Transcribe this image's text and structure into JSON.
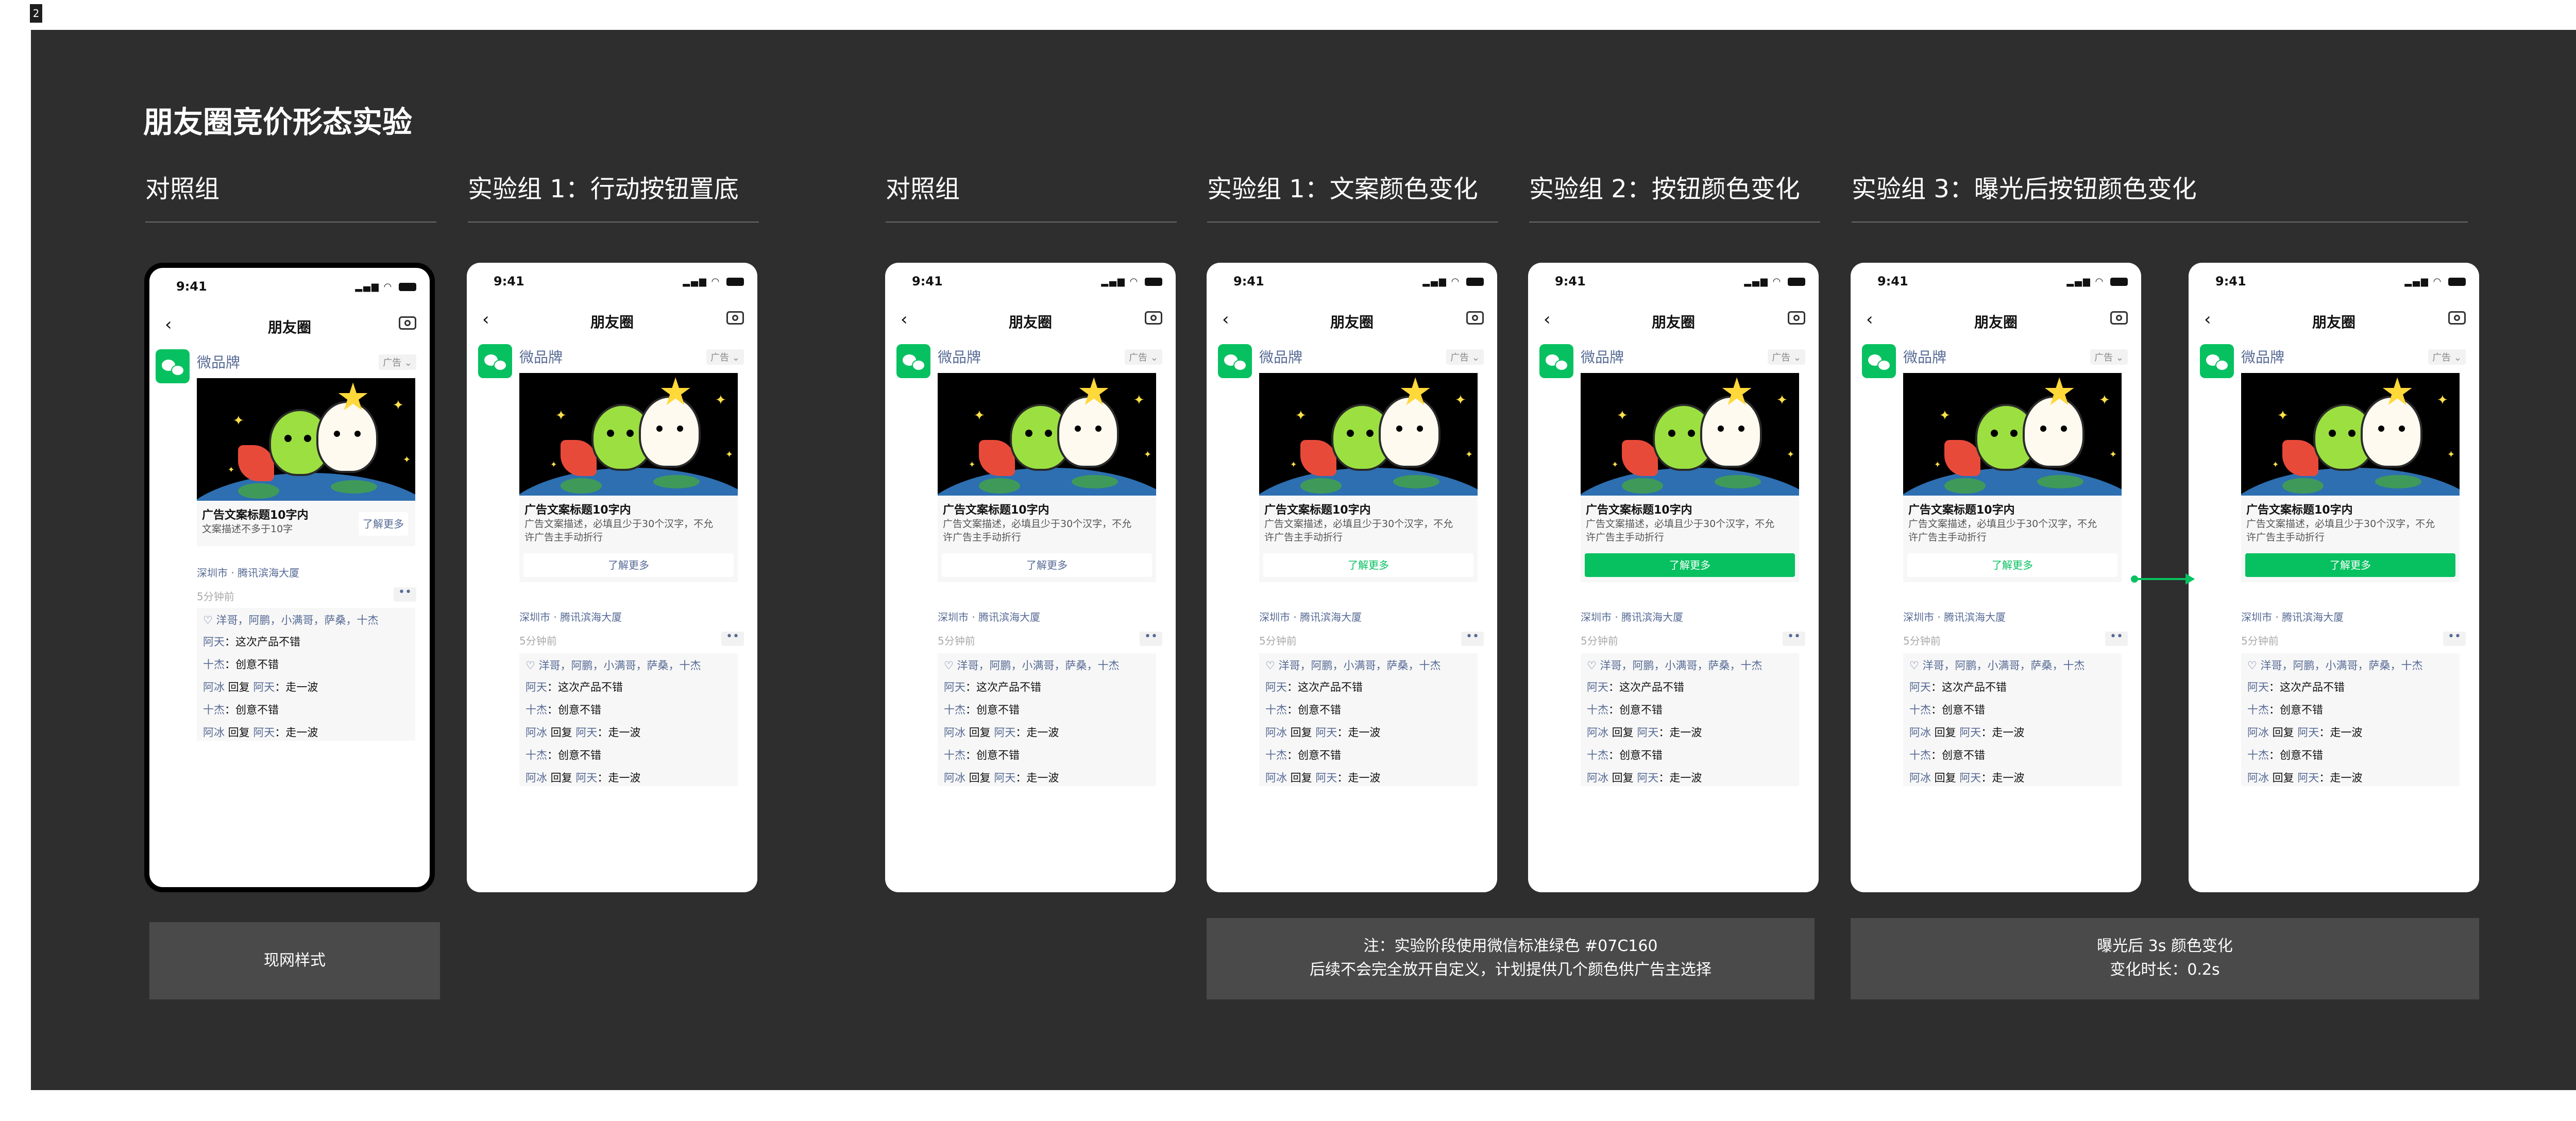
{
  "page_number": "2",
  "board_title": "朋友圈竞价形态实验",
  "groups": [
    {
      "label": "对照组"
    },
    {
      "label": "实验组 1：行动按钮置底"
    },
    {
      "label": "对照组"
    },
    {
      "label": "实验组 1：文案颜色变化"
    },
    {
      "label": "实验组 2：按钮颜色变化"
    },
    {
      "label": "实验组 3：曝光后按钮颜色变化"
    }
  ],
  "phone": {
    "time": "9:41",
    "signal_icon": "signal-wifi-battery",
    "nav_title": "朋友圈",
    "back_icon": "‹",
    "brand": "微品牌",
    "ad_tag": "广告 ⌄",
    "ad_title": "广告文案标题10字内",
    "ad_desc_short": "文案描述不多于10字",
    "ad_desc_line1": "广告文案描述，必填且少于30个汉字，不允",
    "ad_desc_line2": "许广告主手动折行",
    "button_label": "了解更多",
    "location": "深圳市 · 腾讯滨海大厦",
    "time_ago": "5分钟前",
    "dots": "••",
    "likes": "♡ 洋哥，阿鹏，小满哥，萨桑，十杰",
    "comments": [
      {
        "name": "阿天",
        "text": "：这次产品不错"
      },
      {
        "name": "十杰",
        "text": "：创意不错"
      },
      {
        "name": "阿冰",
        "reply": " 回复 ",
        "to": "阿天",
        "text": "：走一波"
      },
      {
        "name": "十杰",
        "text": "：创意不错"
      },
      {
        "name": "阿冰",
        "reply": " 回复 ",
        "to": "阿天",
        "text": "：走一波"
      }
    ]
  },
  "notes": {
    "current": "现网样式",
    "color_note_line1": "注：实验阶段使用微信标准绿色 #07C160",
    "color_note_line2": "后续不会完全放开自定义，计划提供几个颜色供广告主选择",
    "exposure_line1": "曝光后 3s 颜色变化",
    "exposure_line2": "变化时长：0.2s"
  },
  "colors": {
    "wechat_green": "#07C160",
    "link_blue": "#576b95",
    "board_bg": "#2e2e2e"
  }
}
